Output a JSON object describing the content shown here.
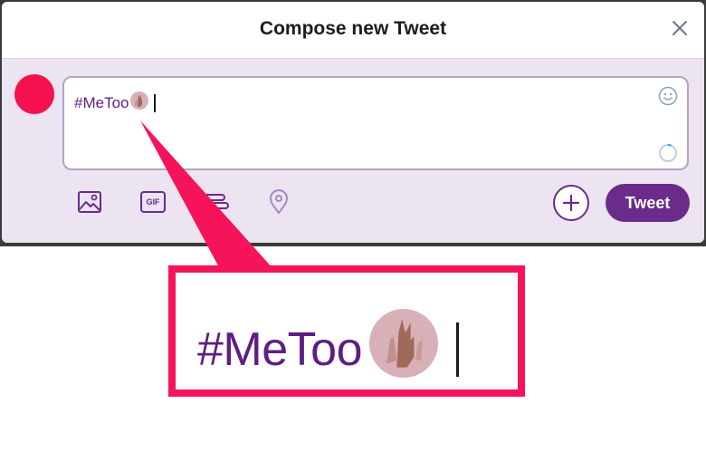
{
  "modal": {
    "title": "Compose new Tweet",
    "close_icon": "close-icon"
  },
  "composer": {
    "text": "#MeToo",
    "emoji_icon": "raised-hand-emoji-icon",
    "emoji_picker_icon": "smiley-icon",
    "character_counter_icon": "progress-ring-icon"
  },
  "toolbar": {
    "media_icon": "image-icon",
    "gif_label": "GIF",
    "poll_icon": "poll-icon",
    "location_icon": "location-pin-icon",
    "add_icon": "plus-icon",
    "tweet_label": "Tweet"
  },
  "callout": {
    "zoom_text": "#MeToo",
    "border_color": "#f5145a"
  },
  "colors": {
    "accent": "#6a2c8a",
    "hashtag": "#5f1d83",
    "avatar": "#f5104f",
    "compose_bg": "#ece4f1"
  }
}
